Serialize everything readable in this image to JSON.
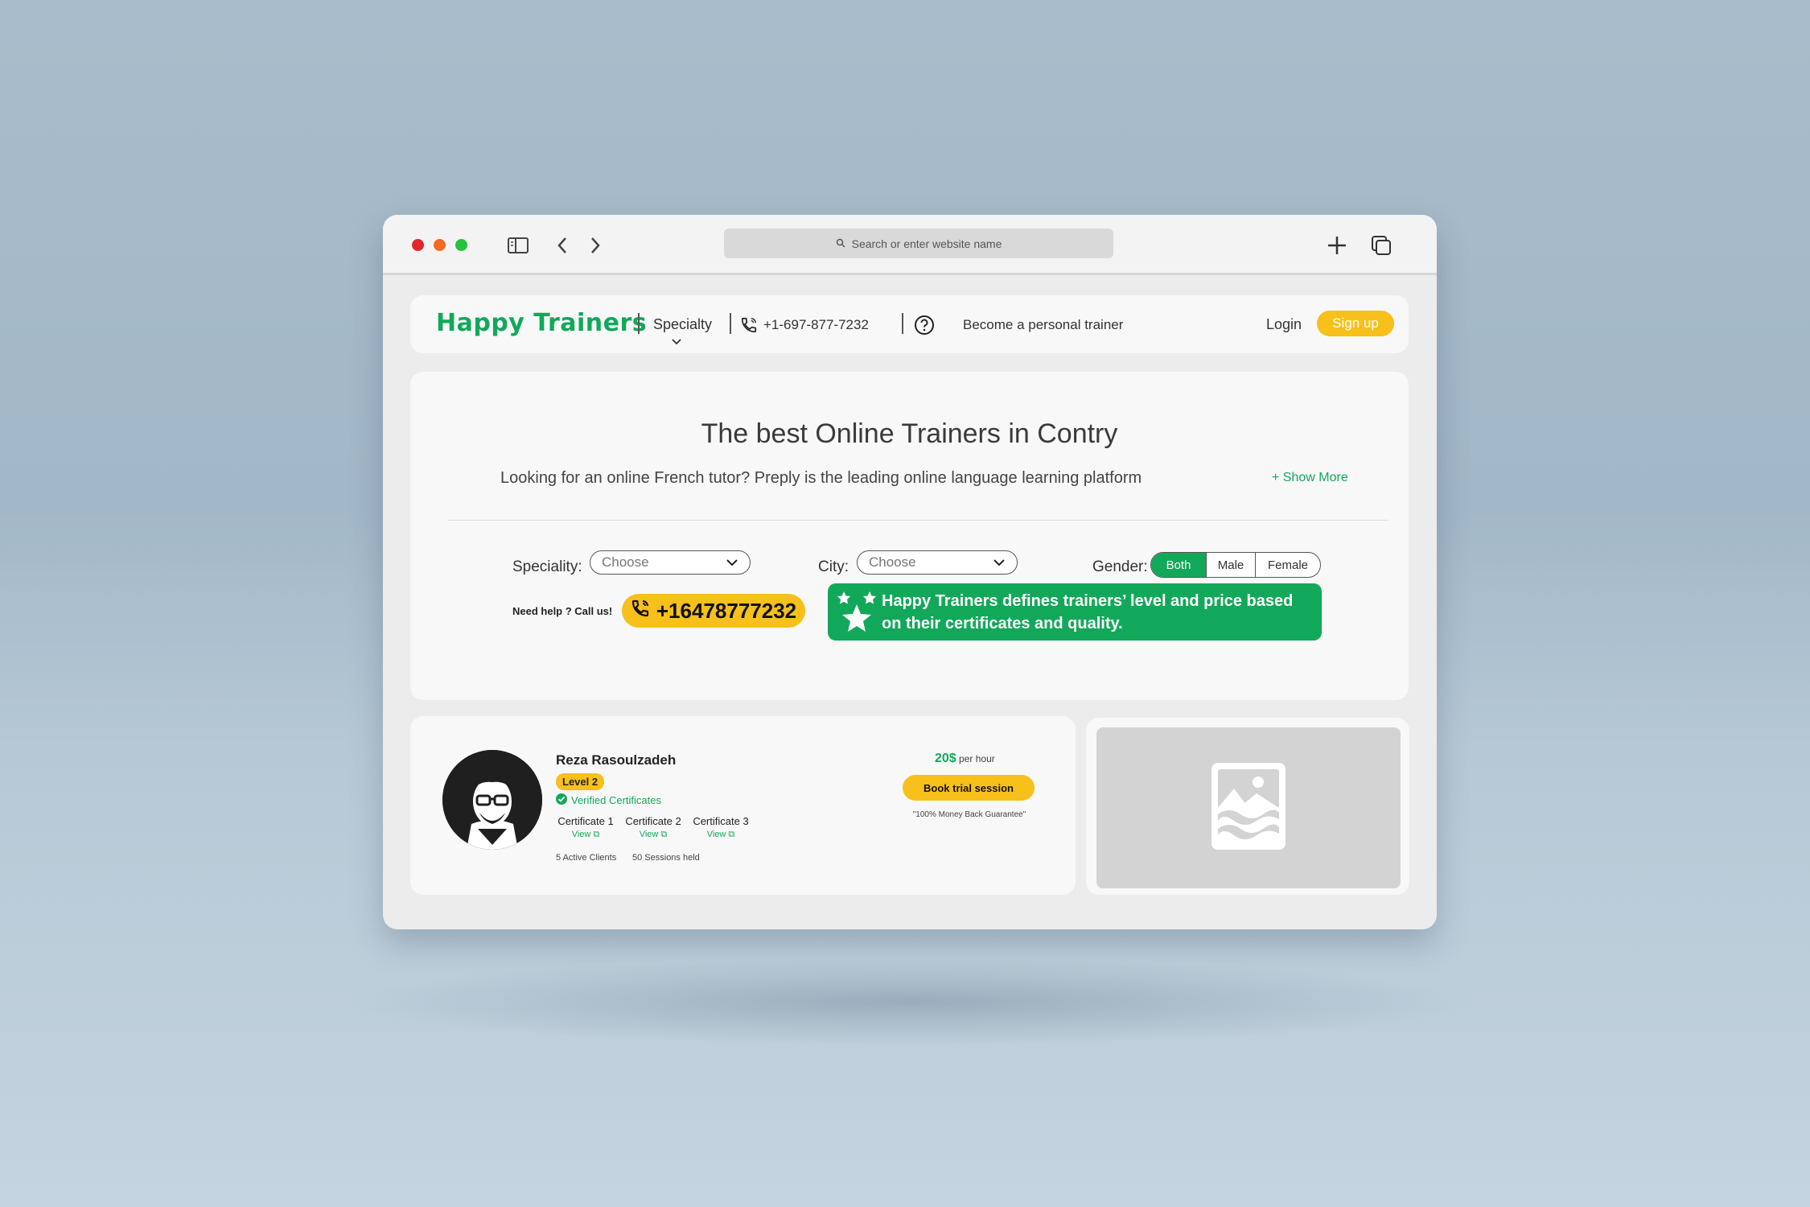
{
  "browser": {
    "address_placeholder": "Search or enter website name"
  },
  "navbar": {
    "logo": "Happy Trainers",
    "specialty": "Specialty",
    "phone": "+1-697-877-7232",
    "become_trainer": "Become a personal trainer",
    "login": "Login",
    "signup": "Sign up"
  },
  "hero": {
    "title": "The best Online Trainers in Contry",
    "subtitle": "Looking for an online French tutor? Preply is the leading online language learning platform",
    "show_more": "+ Show More",
    "speciality_label": "Speciality:",
    "speciality_value": "Choose",
    "city_label": "City:",
    "city_value": "Choose",
    "gender_label": "Gender:",
    "gender_options": [
      "Both",
      "Male",
      "Female"
    ],
    "help_text": "Need help ? Call us!",
    "help_phone": "+16478777232",
    "banner_text": "Happy Trainers defines trainers’ level and price based on their certificates and quality."
  },
  "trainer": {
    "name": "Reza Rasoulzadeh",
    "level": "Level 2",
    "verified": "Verified Certificates",
    "certificates": [
      {
        "title": "Certificate 1",
        "view": "View"
      },
      {
        "title": "Certificate 2",
        "view": "View"
      },
      {
        "title": "Certificate 3",
        "view": "View"
      }
    ],
    "active_clients": "5 Active Clients",
    "sessions_held": "50 Sessions held",
    "price": "20$",
    "price_unit": "per hour",
    "book_button": "Book trial session",
    "guarantee": "\"100% Money Back Guarantee\""
  },
  "colors": {
    "brand_green": "#12a85a",
    "accent_yellow": "#f7c01a"
  }
}
